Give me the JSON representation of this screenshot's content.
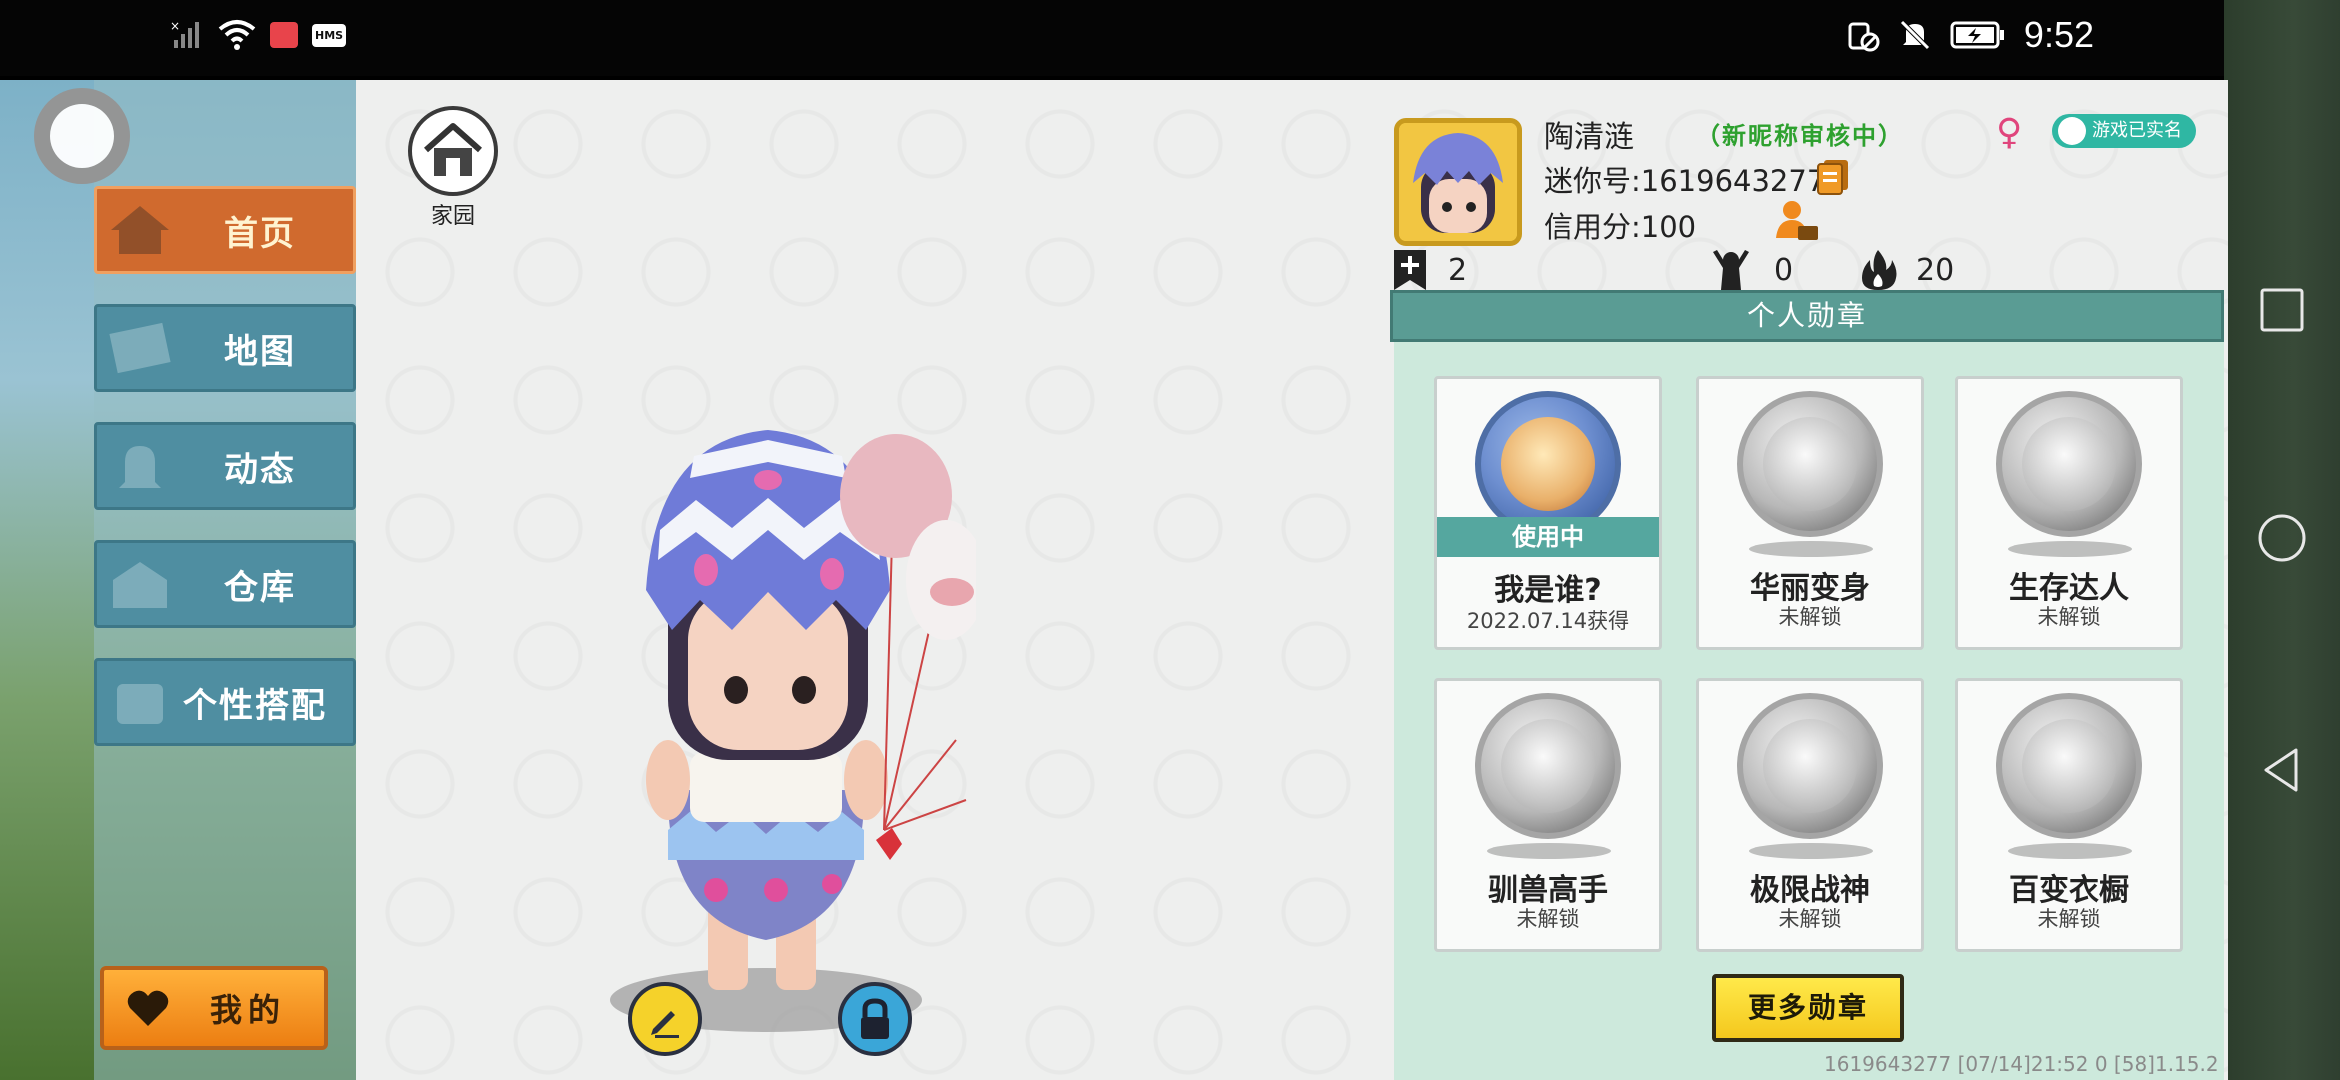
{
  "status_bar": {
    "time": "9:52",
    "left_icons": [
      "signal-off-icon",
      "wifi-icon",
      "app-notification-icon",
      "hms-icon"
    ],
    "hms_label": "HMS",
    "right_icons": [
      "vibrate-off-icon",
      "mute-icon",
      "battery-icon"
    ]
  },
  "sidebar": {
    "items": [
      {
        "label": "首页",
        "icon": "home-icon",
        "active": true
      },
      {
        "label": "地图",
        "icon": "map-icon",
        "active": false
      },
      {
        "label": "动态",
        "icon": "bell-icon",
        "active": false
      },
      {
        "label": "仓库",
        "icon": "warehouse-icon",
        "active": false
      },
      {
        "label": "个性搭配",
        "icon": "outfit-icon",
        "active": false
      }
    ],
    "my_button": "我的"
  },
  "stage": {
    "home_label": "家园"
  },
  "profile": {
    "name": "陶清涟",
    "name_status": "（新昵称审核中）",
    "gender_symbol": "♀",
    "realname_badge": "游戏已实名",
    "mini_id": "迷你号:1619643277",
    "credit": "信用分:100",
    "stats": [
      {
        "icon": "bookmark-plus-icon",
        "value": "2"
      },
      {
        "icon": "cheer-icon",
        "value": "0"
      },
      {
        "icon": "fire-icon",
        "value": "20"
      }
    ]
  },
  "badges": {
    "title": "个人勋章",
    "in_use_label": "使用中",
    "items": [
      {
        "name": "我是谁?",
        "sub": "2022.07.14获得",
        "in_use": true,
        "icon": "letter-medal-icon"
      },
      {
        "name": "华丽变身",
        "sub": "未解锁",
        "in_use": false,
        "icon": "transform-medal-icon"
      },
      {
        "name": "生存达人",
        "sub": "未解锁",
        "in_use": false,
        "icon": "campfire-medal-icon"
      },
      {
        "name": "驯兽高手",
        "sub": "未解锁",
        "in_use": false,
        "icon": "horse-medal-icon"
      },
      {
        "name": "极限战神",
        "sub": "未解锁",
        "in_use": false,
        "icon": "boss-medal-icon"
      },
      {
        "name": "百变衣橱",
        "sub": "未解锁",
        "in_use": false,
        "icon": "wardrobe-medal-icon"
      }
    ],
    "more_button": "更多勋章"
  },
  "footer": "1619643277   [07/14]21:52 0  [58]1.15.2"
}
